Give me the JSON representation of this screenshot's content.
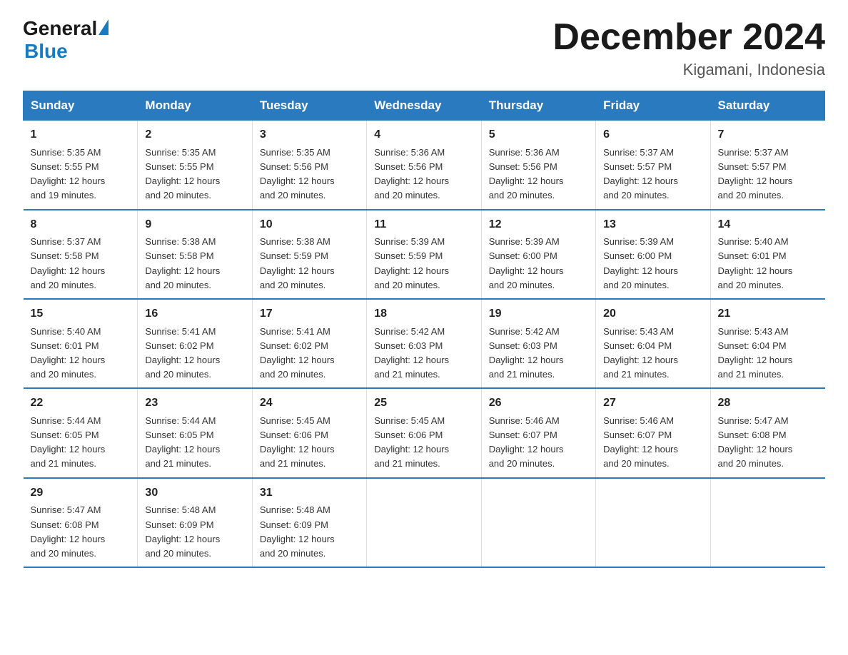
{
  "logo": {
    "general": "General",
    "blue": "Blue"
  },
  "title": "December 2024",
  "location": "Kigamani, Indonesia",
  "days_of_week": [
    "Sunday",
    "Monday",
    "Tuesday",
    "Wednesday",
    "Thursday",
    "Friday",
    "Saturday"
  ],
  "weeks": [
    [
      {
        "day": "1",
        "sunrise": "5:35 AM",
        "sunset": "5:55 PM",
        "daylight": "12 hours and 19 minutes."
      },
      {
        "day": "2",
        "sunrise": "5:35 AM",
        "sunset": "5:55 PM",
        "daylight": "12 hours and 20 minutes."
      },
      {
        "day": "3",
        "sunrise": "5:35 AM",
        "sunset": "5:56 PM",
        "daylight": "12 hours and 20 minutes."
      },
      {
        "day": "4",
        "sunrise": "5:36 AM",
        "sunset": "5:56 PM",
        "daylight": "12 hours and 20 minutes."
      },
      {
        "day": "5",
        "sunrise": "5:36 AM",
        "sunset": "5:56 PM",
        "daylight": "12 hours and 20 minutes."
      },
      {
        "day": "6",
        "sunrise": "5:37 AM",
        "sunset": "5:57 PM",
        "daylight": "12 hours and 20 minutes."
      },
      {
        "day": "7",
        "sunrise": "5:37 AM",
        "sunset": "5:57 PM",
        "daylight": "12 hours and 20 minutes."
      }
    ],
    [
      {
        "day": "8",
        "sunrise": "5:37 AM",
        "sunset": "5:58 PM",
        "daylight": "12 hours and 20 minutes."
      },
      {
        "day": "9",
        "sunrise": "5:38 AM",
        "sunset": "5:58 PM",
        "daylight": "12 hours and 20 minutes."
      },
      {
        "day": "10",
        "sunrise": "5:38 AM",
        "sunset": "5:59 PM",
        "daylight": "12 hours and 20 minutes."
      },
      {
        "day": "11",
        "sunrise": "5:39 AM",
        "sunset": "5:59 PM",
        "daylight": "12 hours and 20 minutes."
      },
      {
        "day": "12",
        "sunrise": "5:39 AM",
        "sunset": "6:00 PM",
        "daylight": "12 hours and 20 minutes."
      },
      {
        "day": "13",
        "sunrise": "5:39 AM",
        "sunset": "6:00 PM",
        "daylight": "12 hours and 20 minutes."
      },
      {
        "day": "14",
        "sunrise": "5:40 AM",
        "sunset": "6:01 PM",
        "daylight": "12 hours and 20 minutes."
      }
    ],
    [
      {
        "day": "15",
        "sunrise": "5:40 AM",
        "sunset": "6:01 PM",
        "daylight": "12 hours and 20 minutes."
      },
      {
        "day": "16",
        "sunrise": "5:41 AM",
        "sunset": "6:02 PM",
        "daylight": "12 hours and 20 minutes."
      },
      {
        "day": "17",
        "sunrise": "5:41 AM",
        "sunset": "6:02 PM",
        "daylight": "12 hours and 20 minutes."
      },
      {
        "day": "18",
        "sunrise": "5:42 AM",
        "sunset": "6:03 PM",
        "daylight": "12 hours and 21 minutes."
      },
      {
        "day": "19",
        "sunrise": "5:42 AM",
        "sunset": "6:03 PM",
        "daylight": "12 hours and 21 minutes."
      },
      {
        "day": "20",
        "sunrise": "5:43 AM",
        "sunset": "6:04 PM",
        "daylight": "12 hours and 21 minutes."
      },
      {
        "day": "21",
        "sunrise": "5:43 AM",
        "sunset": "6:04 PM",
        "daylight": "12 hours and 21 minutes."
      }
    ],
    [
      {
        "day": "22",
        "sunrise": "5:44 AM",
        "sunset": "6:05 PM",
        "daylight": "12 hours and 21 minutes."
      },
      {
        "day": "23",
        "sunrise": "5:44 AM",
        "sunset": "6:05 PM",
        "daylight": "12 hours and 21 minutes."
      },
      {
        "day": "24",
        "sunrise": "5:45 AM",
        "sunset": "6:06 PM",
        "daylight": "12 hours and 21 minutes."
      },
      {
        "day": "25",
        "sunrise": "5:45 AM",
        "sunset": "6:06 PM",
        "daylight": "12 hours and 21 minutes."
      },
      {
        "day": "26",
        "sunrise": "5:46 AM",
        "sunset": "6:07 PM",
        "daylight": "12 hours and 20 minutes."
      },
      {
        "day": "27",
        "sunrise": "5:46 AM",
        "sunset": "6:07 PM",
        "daylight": "12 hours and 20 minutes."
      },
      {
        "day": "28",
        "sunrise": "5:47 AM",
        "sunset": "6:08 PM",
        "daylight": "12 hours and 20 minutes."
      }
    ],
    [
      {
        "day": "29",
        "sunrise": "5:47 AM",
        "sunset": "6:08 PM",
        "daylight": "12 hours and 20 minutes."
      },
      {
        "day": "30",
        "sunrise": "5:48 AM",
        "sunset": "6:09 PM",
        "daylight": "12 hours and 20 minutes."
      },
      {
        "day": "31",
        "sunrise": "5:48 AM",
        "sunset": "6:09 PM",
        "daylight": "12 hours and 20 minutes."
      },
      null,
      null,
      null,
      null
    ]
  ],
  "labels": {
    "sunrise": "Sunrise:",
    "sunset": "Sunset:",
    "daylight": "Daylight:"
  }
}
